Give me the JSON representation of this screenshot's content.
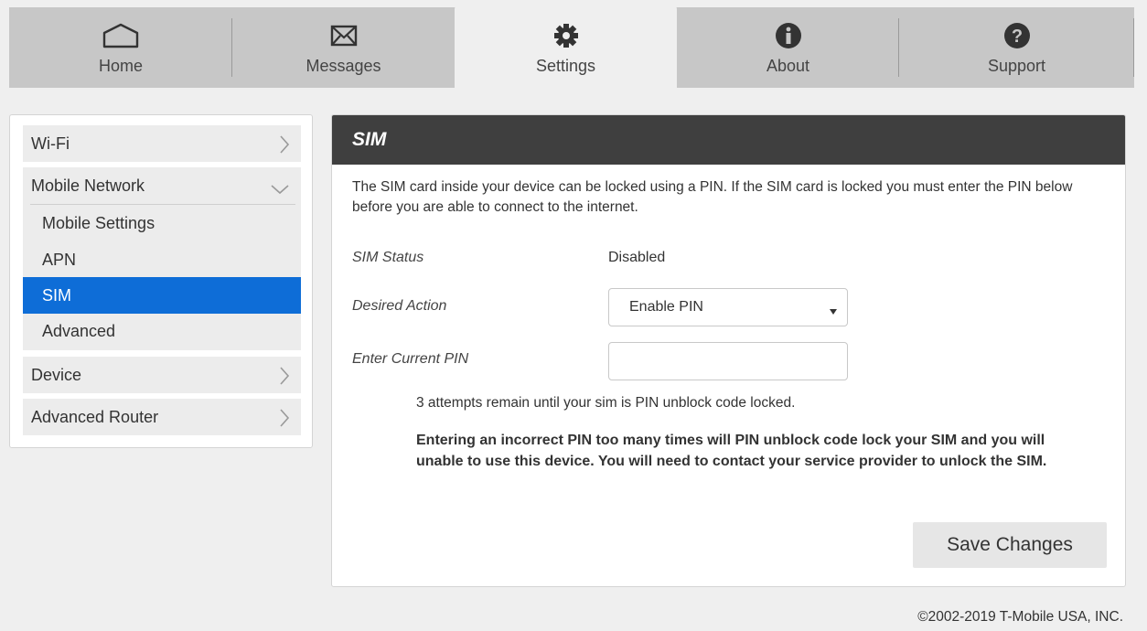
{
  "nav": {
    "tabs": [
      {
        "label": "Home",
        "icon": "home-icon"
      },
      {
        "label": "Messages",
        "icon": "envelope-icon"
      },
      {
        "label": "Settings",
        "icon": "gear-icon",
        "active": true
      },
      {
        "label": "About",
        "icon": "info-icon"
      },
      {
        "label": "Support",
        "icon": "question-icon"
      }
    ]
  },
  "sidebar": {
    "items": [
      {
        "label": "Wi-Fi"
      },
      {
        "label": "Mobile Network",
        "expanded": true,
        "subitems": [
          {
            "label": "Mobile Settings"
          },
          {
            "label": "APN"
          },
          {
            "label": "SIM",
            "selected": true
          },
          {
            "label": "Advanced"
          }
        ]
      },
      {
        "label": "Device"
      },
      {
        "label": "Advanced Router"
      }
    ]
  },
  "panel": {
    "title": "SIM",
    "intro": "The SIM card inside your device can be locked using a PIN. If the SIM card is locked you must enter the PIN below before you are able to connect to the internet.",
    "sim_status_label": "SIM Status",
    "sim_status_value": "Disabled",
    "desired_action_label": "Desired Action",
    "desired_action_value": "Enable PIN",
    "current_pin_label": "Enter Current PIN",
    "current_pin_value": "",
    "attempts_text": "3 attempts remain until your sim is PIN unblock code locked.",
    "warning_text": "Entering an incorrect PIN too many times will PIN unblock code lock your SIM and you will unable to use this device. You will need to contact your service provider to unlock the SIM.",
    "save_label": "Save Changes"
  },
  "footer": {
    "copyright": "©2002-2019 T-Mobile USA, INC."
  },
  "colors": {
    "accent": "#0e6dd7",
    "header_bar": "#3f3f3f",
    "nav_bg": "#c7c7c7"
  }
}
